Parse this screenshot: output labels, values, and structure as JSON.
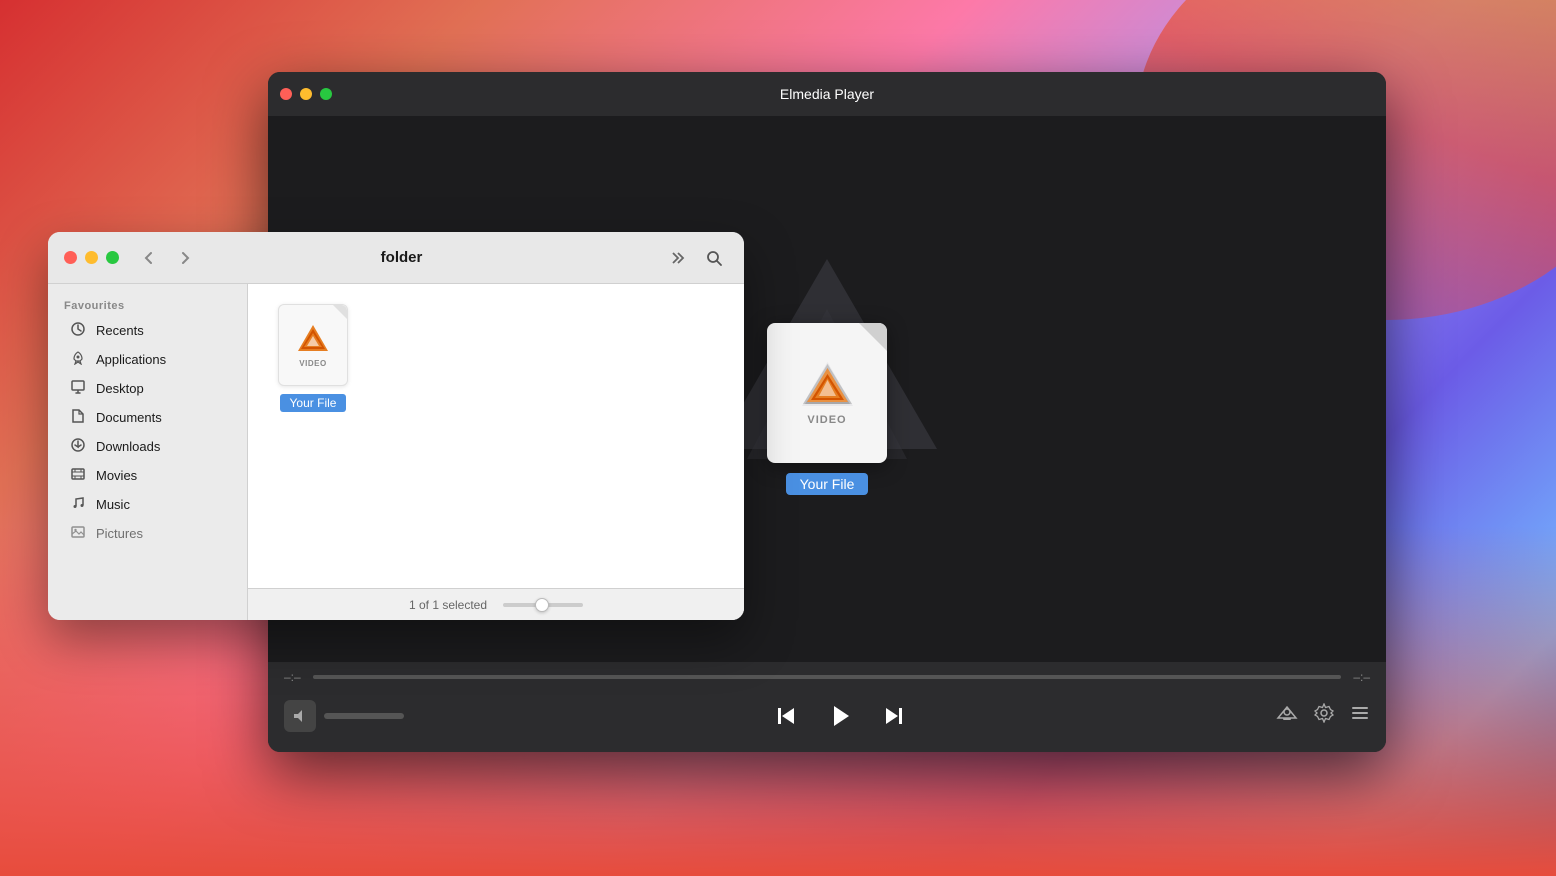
{
  "wallpaper": {},
  "player": {
    "title": "Elmedia Player",
    "traffic_lights": {
      "close": "●",
      "minimize": "●",
      "maximize": "●"
    },
    "file": {
      "label": "VIDEO",
      "name": "Your File"
    },
    "controls": {
      "time_start": "–:–",
      "time_end": "–:–",
      "volume_icon": "🔈",
      "prev_icon": "⏮",
      "play_icon": "▶",
      "next_icon": "⏭",
      "airplay_icon": "⊚",
      "settings_icon": "⚙",
      "playlist_icon": "≡"
    }
  },
  "finder": {
    "title": "folder",
    "section_label": "Favourites",
    "sidebar_items": [
      {
        "id": "recents",
        "label": "Recents",
        "icon": "🕐"
      },
      {
        "id": "applications",
        "label": "Applications",
        "icon": "🚀"
      },
      {
        "id": "desktop",
        "label": "Desktop",
        "icon": "🖥"
      },
      {
        "id": "documents",
        "label": "Documents",
        "icon": "📄"
      },
      {
        "id": "downloads",
        "label": "Downloads",
        "icon": "⬇"
      },
      {
        "id": "movies",
        "label": "Movies",
        "icon": "🎬"
      },
      {
        "id": "music",
        "label": "Music",
        "icon": "🎵"
      },
      {
        "id": "pictures",
        "label": "Pictures",
        "icon": "🖼"
      }
    ],
    "file": {
      "label": "VIDEO",
      "name": "Your File"
    },
    "status": {
      "text": "1 of 1 selected"
    },
    "nav": {
      "back": "‹",
      "forward": "›",
      "more": "»",
      "search": "🔍"
    }
  },
  "colors": {
    "selection_blue": "#4a90e2",
    "tl_close": "#ff5f57",
    "tl_min": "#febc2e",
    "tl_max": "#28c840",
    "player_bg": "#1c1c1e",
    "player_controls_bg": "#2c2c2e"
  }
}
